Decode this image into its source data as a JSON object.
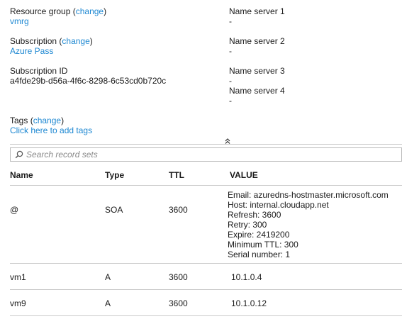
{
  "resource_group": {
    "label": "Resource group",
    "change": "change",
    "value": "vmrg"
  },
  "subscription": {
    "label": "Subscription",
    "change": "change",
    "value": "Azure Pass"
  },
  "subscription_id": {
    "label": "Subscription ID",
    "value": "a4fde29b-d56a-4f6c-8298-6c53cd0b720c"
  },
  "name_servers": [
    {
      "label": "Name  server 1",
      "value": "-"
    },
    {
      "label": "Name server 2",
      "value": "-"
    },
    {
      "label": "Name server 3",
      "value": "-"
    },
    {
      "label": "Name server 4",
      "value": "-"
    }
  ],
  "tags": {
    "label": "Tags",
    "change": "change",
    "add_link": "Click here to add tags"
  },
  "collapse_icon": "double-chevron-up-icon",
  "search": {
    "placeholder": "Search record sets",
    "value": ""
  },
  "table": {
    "headers": [
      "Name",
      "Type",
      "TTL",
      "VALUE"
    ],
    "rows": [
      {
        "name": "@",
        "type": "SOA",
        "ttl": "3600",
        "values": [
          "Email: azuredns-hostmaster.microsoft.com",
          "Host: internal.cloudapp.net",
          "Refresh: 3600",
          "Retry: 300",
          "Expire: 2419200",
          "Minimum TTL: 300",
          "Serial number: 1"
        ]
      },
      {
        "name": "vm1",
        "type": "A",
        "ttl": "3600",
        "values": [
          "10.1.0.4"
        ]
      },
      {
        "name": "vm9",
        "type": "A",
        "ttl": "3600",
        "values": [
          "10.1.0.12"
        ]
      }
    ]
  },
  "colors": {
    "link": "#1e88d2",
    "separator": "#c9c9c9"
  }
}
